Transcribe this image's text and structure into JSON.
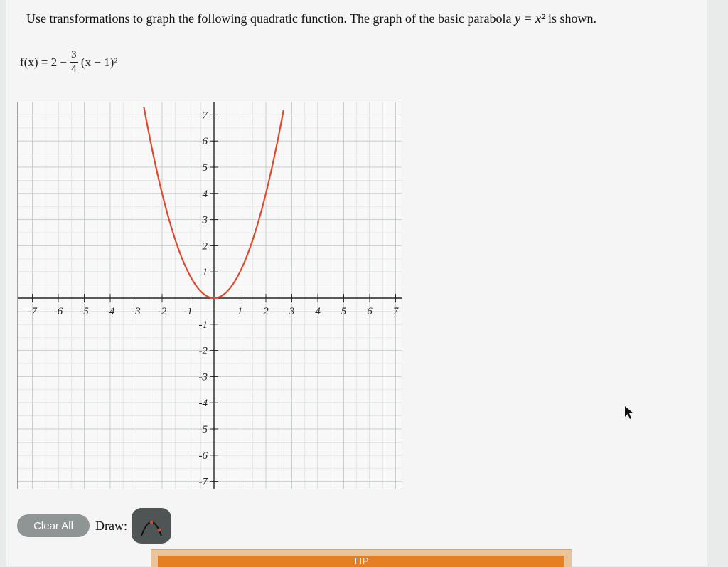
{
  "question": {
    "text_before": "Use transformations to graph the following quadratic function. The graph of the basic parabola",
    "math": "y = x²",
    "text_after": "is shown."
  },
  "function": {
    "lhs": "f(x) = 2 −",
    "numerator": "3",
    "denominator": "4",
    "rhs": "(x − 1)²"
  },
  "graph": {
    "x_ticks": [
      "-7",
      "-6",
      "-5",
      "-4",
      "-3",
      "-2",
      "-1",
      "1",
      "2",
      "3",
      "4",
      "5",
      "6",
      "7"
    ],
    "y_ticks": [
      "7",
      "6",
      "5",
      "4",
      "3",
      "2",
      "1",
      "-1",
      "-2",
      "-3",
      "-4",
      "-5",
      "-6",
      "-7"
    ],
    "x_range": [
      -7,
      7
    ],
    "y_range": [
      -7,
      7
    ],
    "curve": "y = x²",
    "curve_color": "#e0482f",
    "grid_color": "#c9cfce",
    "axis_color": "#222222"
  },
  "controls": {
    "clear_label": "Clear All",
    "draw_label": "Draw:",
    "draw_tool_icon": "parabola-tool-icon"
  },
  "tip": {
    "label": "TIP"
  }
}
